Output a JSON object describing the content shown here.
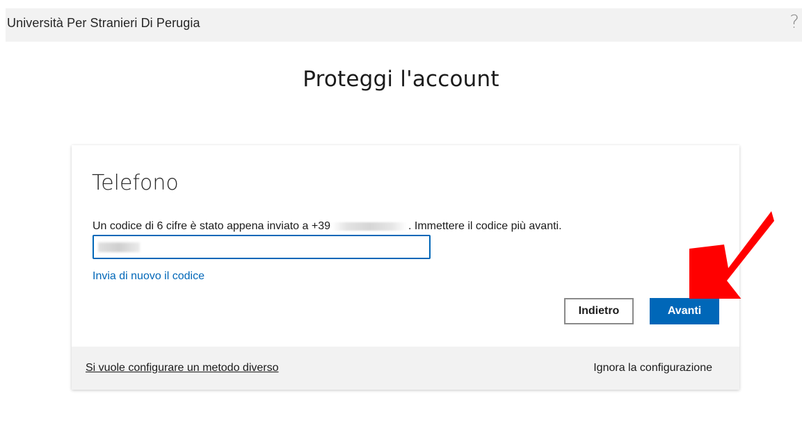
{
  "header": {
    "org_name": "Università Per Stranieri Di Perugia",
    "help_glyph": "?"
  },
  "page_title": "Proteggi l'account",
  "phone_step": {
    "section_title": "Telefono",
    "instruction_prefix": "Un codice di 6 cifre è stato appena inviato a +39",
    "instruction_suffix": ". Immettere il codice più avanti.",
    "code_value": "",
    "resend_link": "Invia di nuovo il codice",
    "back_button": "Indietro",
    "next_button": "Avanti"
  },
  "footer": {
    "alt_method_link": "Si vuole configurare un metodo diverso",
    "skip_link": "Ignora la configurazione"
  },
  "colors": {
    "accent": "#0067b8",
    "topbar_bg": "#f2f2f2",
    "annotation_arrow": "#ff0000"
  },
  "icons": {
    "help": "help-icon",
    "annotation": "red-arrow-annotation"
  }
}
